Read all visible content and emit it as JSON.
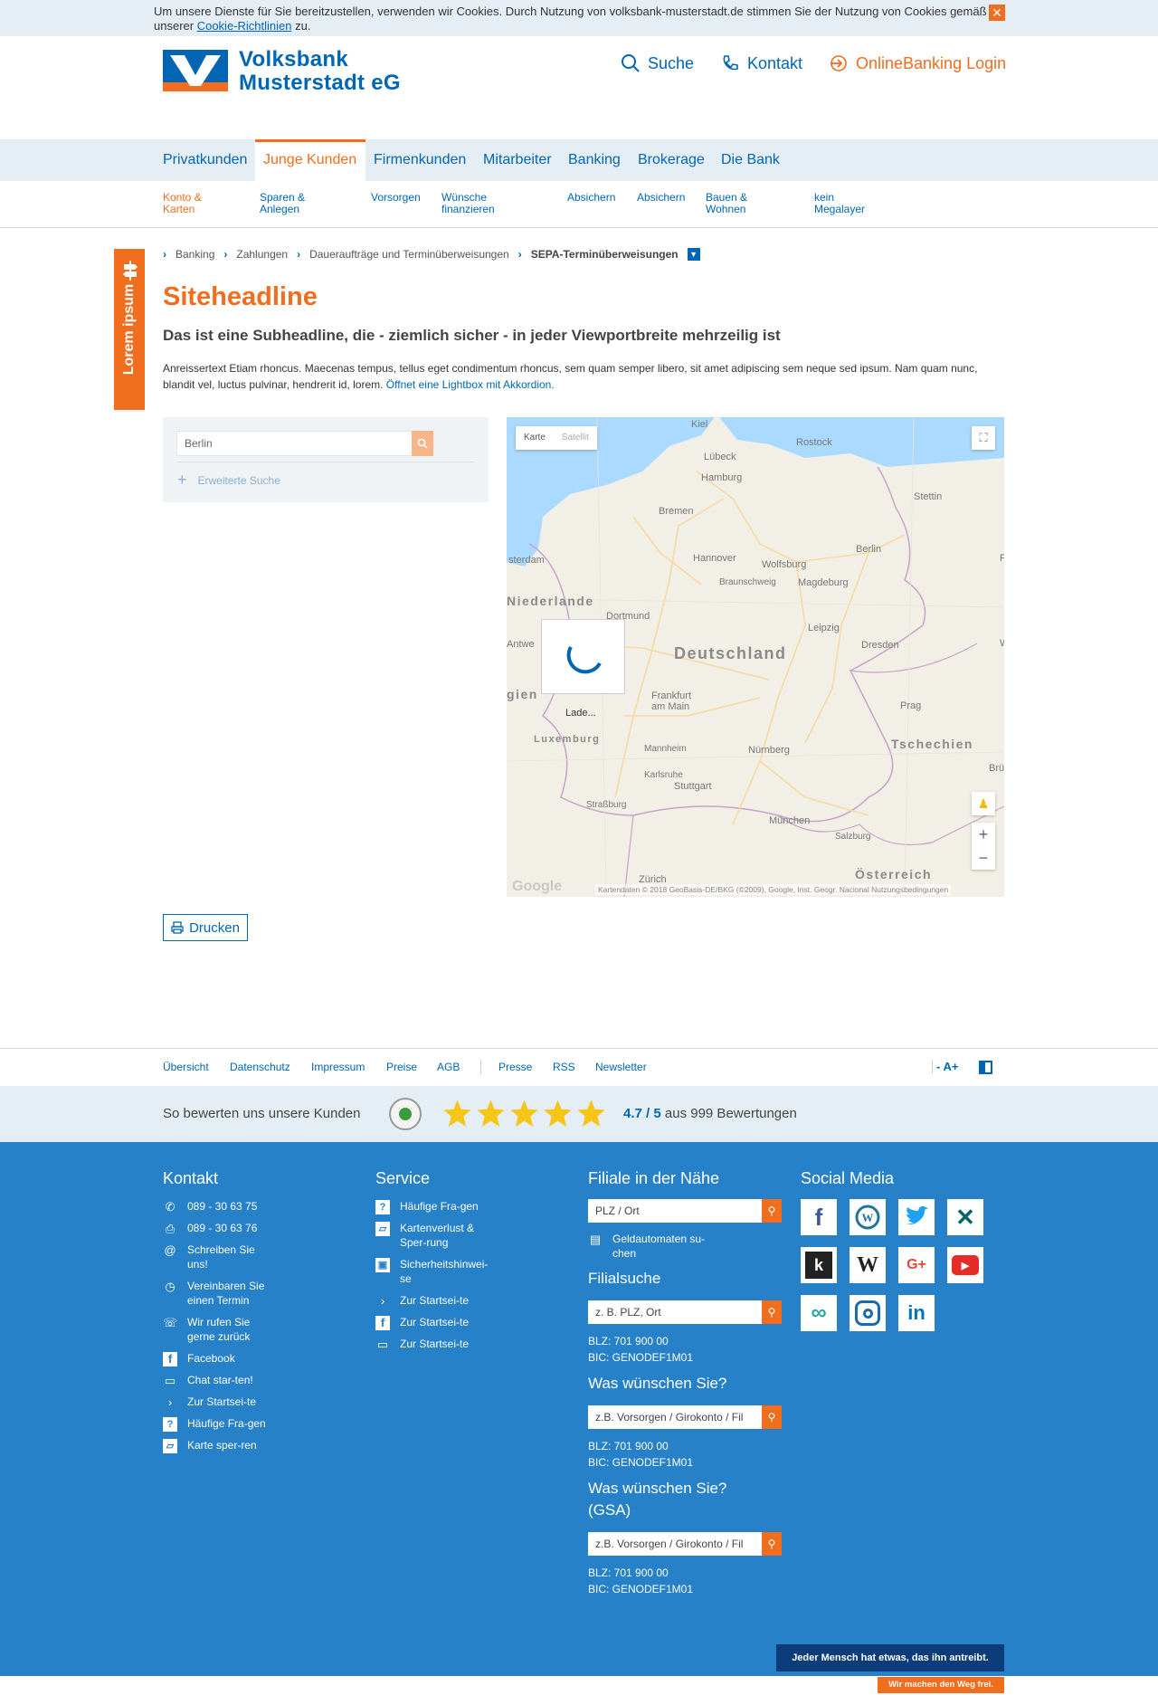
{
  "cookie": {
    "text": "Um unsere Dienste für Sie bereitzustellen, verwenden wir Cookies. Durch Nutzung von volksbank-musterstadt.de stimmen Sie der Nutzung von Cookies gemäß unserer ",
    "link": "Cookie-Richtlinien",
    "suffix": " zu.",
    "close": "✕"
  },
  "brand": {
    "line1": "Volksbank",
    "line2": "Musterstadt eG"
  },
  "header": {
    "search": "Suche",
    "contact": "Kontakt",
    "login": "OnlineBanking Login"
  },
  "mainnav": [
    "Privatkunden",
    "Junge Kunden",
    "Firmenkunden",
    "Mitarbeiter",
    "Banking",
    "Brokerage",
    "Die Bank"
  ],
  "subnav": [
    {
      "l1": "Konto &",
      "l2": "Karten"
    },
    {
      "l1": "Sparen &",
      "l2": "Anlegen"
    },
    {
      "l1": "Vorsorgen",
      "l2": ""
    },
    {
      "l1": "Wünsche",
      "l2": "finanzieren"
    },
    {
      "l1": "Absichern",
      "l2": ""
    },
    {
      "l1": "Absichern",
      "l2": ""
    },
    {
      "l1": "Bauen &",
      "l2": "Wohnen"
    },
    {
      "l1": "kein",
      "l2": "Megalayer"
    }
  ],
  "sidetab": "Lorem ipsum",
  "breadcrumb": [
    "Banking",
    "Zahlungen",
    "Daueraufträge und Terminüberweisungen",
    "SEPA-Terminüberweisungen"
  ],
  "headline": "Siteheadline",
  "subheadline": "Das ist eine Subheadline, die - ziemlich sicher - in jeder Viewportbreite mehrzeilig ist",
  "teaser": {
    "text": "Anreissertext Etiam rhoncus. Maecenas tempus, tellus eget condimentum rhoncus, sem quam semper libero, sit amet adipiscing sem neque sed ipsum. Nam quam nunc, blandit vel, luctus pulvinar, hendrerit id, lorem. ",
    "link": "Öffnet eine Lightbox mit Akkordion."
  },
  "branchsearch": {
    "value": "Berlin",
    "advanced": "Erweiterte Suche"
  },
  "map": {
    "tab_map": "Karte",
    "tab_sat": "Satellit",
    "loading": "Lade...",
    "google": "Google",
    "copyright": "Kartendaten © 2018 GeoBasis-DE/BKG (©2009), Google, Inst. Geogr. Nacional   Nutzungsbedingungen",
    "countries": [
      "Deutschland",
      "Tschechien",
      "Niederlande",
      "Österreich",
      "Luxemburg",
      "gien"
    ],
    "cities": [
      "Kiel",
      "Rostock",
      "Lübeck",
      "Hamburg",
      "Stettin",
      "Bremen",
      "sterdam",
      "Hannover",
      "Wolfsburg",
      "Berlin",
      "Braunschweig",
      "Magdeburg",
      "Dortmund",
      "Leipzig",
      "Antwe",
      "Dresden",
      "Frankfurt am Main",
      "Prag",
      "Mannheim",
      "Nürnberg",
      "Karlsruhe",
      "Stuttgart",
      "Straßburg",
      "München",
      "Salzburg",
      "Zürich",
      "Brü",
      "P",
      "W"
    ]
  },
  "print": "Drucken",
  "footerlinks": [
    "Übersicht",
    "Datenschutz",
    "Impressum",
    "Preise",
    "AGB",
    "Presse",
    "RSS",
    "Newsletter"
  ],
  "fontsize": "- A+",
  "rating": {
    "label": "So bewerten uns unsere Kunden",
    "score": "4.7",
    "max": " / 5",
    "suffix": " aus 999 Bewertungen",
    "stars": 5
  },
  "footer": {
    "kontakt": {
      "title": "Kontakt",
      "items": [
        {
          "icon": "phone-icon",
          "text": "089 - 30 63 75"
        },
        {
          "icon": "fax-icon",
          "text": "089 - 30 63 76"
        },
        {
          "icon": "at-icon",
          "text": "Schreiben Sie uns!"
        },
        {
          "icon": "clock-icon",
          "text": "Vereinbaren Sie einen Termin"
        },
        {
          "icon": "callback-icon",
          "text": "Wir rufen Sie gerne zurück"
        },
        {
          "icon": "facebook-icon",
          "text": "Facebook"
        },
        {
          "icon": "chat-icon",
          "text": "Chat star-ten!"
        },
        {
          "icon": "chevron-right-icon",
          "text": "Zur Startsei-te"
        },
        {
          "icon": "faq-icon",
          "text": "Häufige Fra-gen"
        },
        {
          "icon": "card-block-icon",
          "text": "Karte sper-ren"
        }
      ]
    },
    "service": {
      "title": "Service",
      "items": [
        {
          "icon": "faq-icon",
          "text": "Häufige Fra-gen"
        },
        {
          "icon": "card-block-icon",
          "text": "Kartenverlust & Sper-rung"
        },
        {
          "icon": "lock-icon",
          "text": "Sicherheitshinwei-se"
        },
        {
          "icon": "chevron-right-icon",
          "text": "Zur Startsei-te"
        },
        {
          "icon": "facebook-icon",
          "text": "Zur Startsei-te"
        },
        {
          "icon": "chat-icon",
          "text": "Zur Startsei-te"
        }
      ]
    },
    "filiale": {
      "title": "Filiale in der Nähe",
      "placeholder": "PLZ / Ort",
      "atm": "Geldautomaten su-chen",
      "filialsuche": "Filialsuche",
      "filial_placeholder": "z. B. PLZ, Ort",
      "blz1": "BLZ: 701 900 00",
      "bic1": "BIC: GENODEF1M01",
      "wish": "Was wünschen Sie?",
      "wish_placeholder": "z.B. Vorsorgen / Girokonto / Fil",
      "blz2": "BLZ: 701 900 00",
      "bic2": "BIC: GENODEF1M01",
      "wish_gsa": "Was wünschen Sie? (GSA)",
      "wish_gsa_placeholder": "z.B. Vorsorgen / Girokonto / Fil",
      "blz3": "BLZ: 701 900 00",
      "bic3": "BIC: GENODEF1M01"
    },
    "social": {
      "title": "Social Media",
      "icons": [
        "facebook-icon",
        "wordpress-icon",
        "twitter-icon",
        "xing-icon",
        "kununu-icon",
        "wikipedia-icon",
        "google-plus-icon",
        "youtube-icon",
        "infinity-icon",
        "instagram-icon",
        "linkedin-icon"
      ]
    }
  },
  "claim": "Jeder Mensch hat etwas, das ihn antreibt.",
  "claim2": "Wir machen den Weg frei.",
  "colors": {
    "brand_blue": "#0066b3",
    "brand_orange": "#f06e1e",
    "footer_blue": "#2781c8",
    "light_bg": "#e6eef5"
  }
}
